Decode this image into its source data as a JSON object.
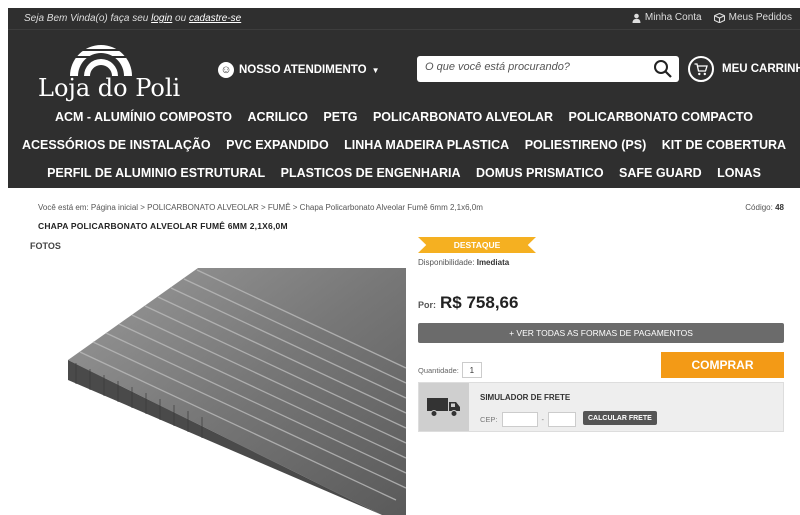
{
  "topbar": {
    "welcome_prefix": "Seja Bem Vinda(o) faça seu",
    "login_label": "login",
    "welcome_or": "ou",
    "signup_label": "cadastre-se",
    "account_label": "Minha Conta",
    "orders_label": "Meus Pedidos"
  },
  "header": {
    "logo_text": "Loja do Poli",
    "service_label": "NOSSO ATENDIMENTO",
    "search_placeholder": "O que você está procurando?",
    "cart_label": "MEU CARRINHO"
  },
  "nav": {
    "row1": [
      "ACM - ALUMÍNIO COMPOSTO",
      "ACRILICO",
      "PETG",
      "POLICARBONATO ALVEOLAR",
      "POLICARBONATO COMPACTO"
    ],
    "row2": [
      "ACESSÓRIOS DE INSTALAÇÃO",
      "PVC EXPANDIDO",
      "LINHA MADEIRA PLASTICA",
      "POLIESTIRENO (PS)",
      "KIT DE COBERTURA"
    ],
    "row3": [
      "PERFIL DE ALUMINIO ESTRUTURAL",
      "PLASTICOS DE ENGENHARIA",
      "DOMUS PRISMATICO",
      "SAFE GUARD",
      "LONAS"
    ]
  },
  "product": {
    "breadcrumb": "Você está em: Página inicial > POLICARBONATO ALVEOLAR > FUMÊ > Chapa Policarbonato Alveolar Fumê 6mm 2,1x6,0m",
    "code_label": "Código:",
    "code_value": "48",
    "title": "CHAPA POLICARBONATO ALVEOLAR FUMÊ 6MM 2,1X6,0M",
    "photos_label": "FOTOS",
    "badge": "DESTAQUE",
    "availability_label": "Disponibilidade:",
    "availability_value": "Imediata",
    "price_prefix": "Por:",
    "price": "R$ 758,66",
    "payment_button": "+ VER TODAS AS FORMAS DE PAGAMENTOS",
    "quantity_label": "Quantidade:",
    "quantity_value": "1",
    "buy_button": "COMPRAR"
  },
  "shipping": {
    "title": "SIMULADOR DE FRETE",
    "cep_label": "CEP:",
    "cep_separator": "-",
    "calc_button": "CALCULAR FRETE"
  },
  "colors": {
    "header_bg": "#2f2f2f",
    "accent_orange": "#f39a16",
    "badge_yellow": "#f5b021",
    "payment_gray": "#6b6b6b"
  },
  "icons": [
    "user-icon",
    "box-icon",
    "face-icon",
    "caret-down-icon",
    "search-icon",
    "cart-icon",
    "truck-icon"
  ]
}
